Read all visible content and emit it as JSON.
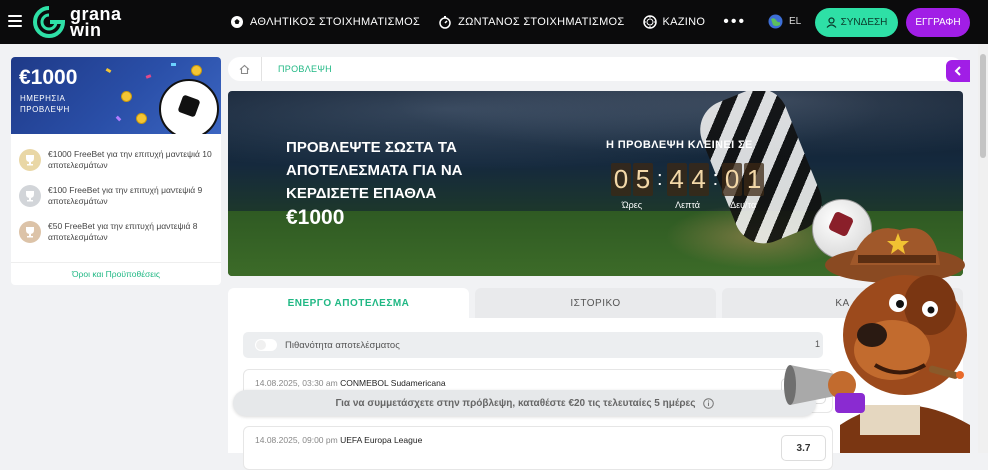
{
  "header": {
    "logo_text_line1": "grana",
    "logo_text_line2": "win",
    "nav": [
      {
        "label": "ΑΘΛΗΤΙΚΟΣ ΣΤΟΙΧΗΜΑΤΙΣΜΟΣ",
        "icon": "soccer-ball-icon"
      },
      {
        "label": "ΖΩΝΤΑΝΟΣ ΣΤΟΙΧΗΜΑΤΙΣΜΟΣ",
        "icon": "stopwatch-icon"
      },
      {
        "label": "ΚΑΖΙΝΟ",
        "icon": "casino-chip-icon"
      }
    ],
    "more": "•••",
    "language": "EL",
    "login_label": "ΣΥΝΔΕΣΗ",
    "register_label": "ΕΓΓΡΑΦΗ"
  },
  "promo": {
    "amount": "€1000",
    "subtitle_line1": "ΗΜΕΡΗΣΙΑ",
    "subtitle_line2": "ΠΡΟΒΛΕΨΗ",
    "tiers": [
      {
        "text": "€1000 FreeBet για την επιτυχή μαντεψιά 10 αποτελεσμάτων",
        "medal": "gold"
      },
      {
        "text": "€100 FreeBet για την επιτυχή μαντεψιά 9 αποτελεσμάτων",
        "medal": "silver"
      },
      {
        "text": "€50 FreeBet για την επιτυχή μαντεψιά 8 αποτελεσμάτων",
        "medal": "bronze"
      }
    ],
    "terms_link": "Όροι και Προϋποθέσεις"
  },
  "breadcrumb": {
    "current": "ΠΡΟΒΛΕΨΗ"
  },
  "hero": {
    "title": "ΠΡΟΒΛΕΨΤΕ ΣΩΣΤΑ ΤΑ ΑΠΟΤΕΛΕΣΜΑΤΑ ΓΙΑ ΝΑ ΚΕΡΔΙΣΕΤΕ ΕΠΑΘΛΑ",
    "amount": "€1000",
    "countdown_label": "Η ΠΡΟΒΛΕΨΗ ΚΛΕΙΝΕΙ ΣΕ",
    "hours": "05",
    "minutes": "44",
    "seconds": "01",
    "hours_label": "Ώρες",
    "minutes_label": "Λεπτά",
    "seconds_label": "Δευ/τα"
  },
  "tabs": [
    {
      "label": "ΕΝΕΡΓΟ ΑΠΟΤΕΛΕΣΜΑ",
      "active": true
    },
    {
      "label": "ΙΣΤΟΡΙΚΟ",
      "active": false
    },
    {
      "label": "ΚΑ",
      "active": false
    }
  ],
  "panel": {
    "toggle_label": "Πιθανότητα αποτελέσματος",
    "toggle_value": "1",
    "matches": [
      {
        "datetime": "14.08.2025, 03:30 am",
        "league": "CONMEBOL Sudamericana",
        "odd": ""
      },
      {
        "datetime": "14.08.2025, 09:00 pm",
        "league": "UEFA Europa League",
        "odd": "3.7"
      }
    ]
  },
  "notice": "Για να συμμετάσχετε στην πρόβλεψη, καταθέστε €20 τις τελευταίες 5 ημέρες",
  "colors": {
    "accent_green": "#2ee0a6",
    "brand_purple": "#a11ee6",
    "link_green": "#20b884"
  }
}
